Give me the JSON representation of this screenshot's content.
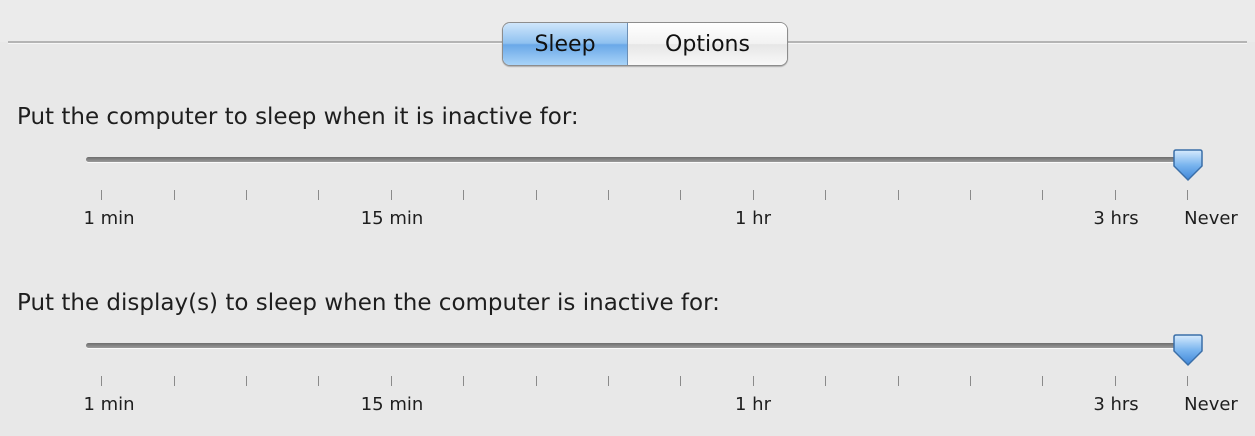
{
  "tabs": [
    {
      "label": "Sleep",
      "selected": true
    },
    {
      "label": "Options",
      "selected": false
    }
  ],
  "computer_sleep": {
    "label": "Put the computer to sleep when it is inactive for:",
    "value": "Never",
    "tick_labels": [
      "1 min",
      "15 min",
      "1 hr",
      "3 hrs",
      "Never"
    ]
  },
  "display_sleep": {
    "label": "Put the display(s) to sleep when the computer is inactive for:",
    "value": "Never",
    "tick_labels": [
      "1 min",
      "15 min",
      "1 hr",
      "3 hrs",
      "Never"
    ]
  },
  "colors": {
    "accent": "#6aa8e8",
    "knob": "#5c9fe6",
    "background": "#e8e8e8"
  }
}
